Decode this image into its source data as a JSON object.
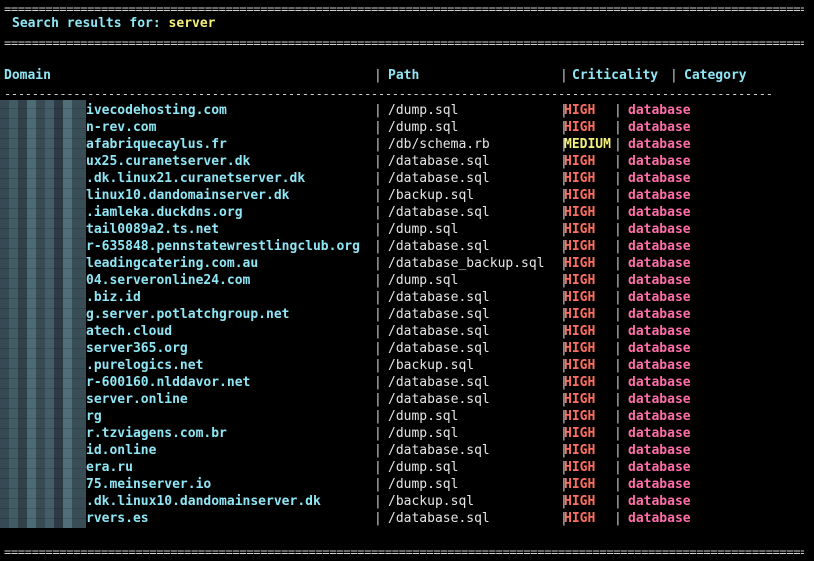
{
  "separators": {
    "top1": "==================================================================================================================================================",
    "top2": "==================================================================================================================================================",
    "header": "---------------------------------------------------------------------------------------------------------------------------------",
    "bottom": "=================================================================================================================================================="
  },
  "search": {
    "label": "Search results for:",
    "query": "server"
  },
  "headers": {
    "domain": "Domain",
    "path": "Path",
    "criticality": "Criticality",
    "category": "Category"
  },
  "pipe": "|",
  "rows": [
    {
      "domain": "ivecodehosting.com",
      "path": "/dump.sql",
      "criticality": "HIGH",
      "category": "database"
    },
    {
      "domain": "n-rev.com",
      "path": "/dump.sql",
      "criticality": "HIGH",
      "category": "database"
    },
    {
      "domain": "afabriquecaylus.fr",
      "path": "/db/schema.rb",
      "criticality": "MEDIUM",
      "category": "database"
    },
    {
      "domain": "ux25.curanetserver.dk",
      "path": "/database.sql",
      "criticality": "HIGH",
      "category": "database"
    },
    {
      "domain": ".dk.linux21.curanetserver.dk",
      "path": "/database.sql",
      "criticality": "HIGH",
      "category": "database"
    },
    {
      "domain": "linux10.dandomainserver.dk",
      "path": "/backup.sql",
      "criticality": "HIGH",
      "category": "database"
    },
    {
      "domain": ".iamleka.duckdns.org",
      "path": "/database.sql",
      "criticality": "HIGH",
      "category": "database"
    },
    {
      "domain": "tail0089a2.ts.net",
      "path": "/dump.sql",
      "criticality": "HIGH",
      "category": "database"
    },
    {
      "domain": "r-635848.pennstatewrestlingclub.org",
      "path": "/database.sql",
      "criticality": "HIGH",
      "category": "database"
    },
    {
      "domain": "leadingcatering.com.au",
      "path": "/database_backup.sql",
      "criticality": "HIGH",
      "category": "database"
    },
    {
      "domain": "04.serveronline24.com",
      "path": "/dump.sql",
      "criticality": "HIGH",
      "category": "database"
    },
    {
      "domain": ".biz.id",
      "path": "/database.sql",
      "criticality": "HIGH",
      "category": "database"
    },
    {
      "domain": "g.server.potlatchgroup.net",
      "path": "/database.sql",
      "criticality": "HIGH",
      "category": "database"
    },
    {
      "domain": "atech.cloud",
      "path": "/database.sql",
      "criticality": "HIGH",
      "category": "database"
    },
    {
      "domain": "server365.org",
      "path": "/database.sql",
      "criticality": "HIGH",
      "category": "database"
    },
    {
      "domain": ".purelogics.net",
      "path": "/backup.sql",
      "criticality": "HIGH",
      "category": "database"
    },
    {
      "domain": "r-600160.nlddavor.net",
      "path": "/database.sql",
      "criticality": "HIGH",
      "category": "database"
    },
    {
      "domain": "server.online",
      "path": "/database.sql",
      "criticality": "HIGH",
      "category": "database"
    },
    {
      "domain": "rg",
      "path": "/dump.sql",
      "criticality": "HIGH",
      "category": "database"
    },
    {
      "domain": "r.tzviagens.com.br",
      "path": "/dump.sql",
      "criticality": "HIGH",
      "category": "database"
    },
    {
      "domain": "id.online",
      "path": "/database.sql",
      "criticality": "HIGH",
      "category": "database"
    },
    {
      "domain": "era.ru",
      "path": "/dump.sql",
      "criticality": "HIGH",
      "category": "database"
    },
    {
      "domain": "75.meinserver.io",
      "path": "/dump.sql",
      "criticality": "HIGH",
      "category": "database"
    },
    {
      "domain": ".dk.linux10.dandomainserver.dk",
      "path": "/backup.sql",
      "criticality": "HIGH",
      "category": "database"
    },
    {
      "domain": "rvers.es",
      "path": "/database.sql",
      "criticality": "HIGH",
      "category": "database"
    }
  ]
}
